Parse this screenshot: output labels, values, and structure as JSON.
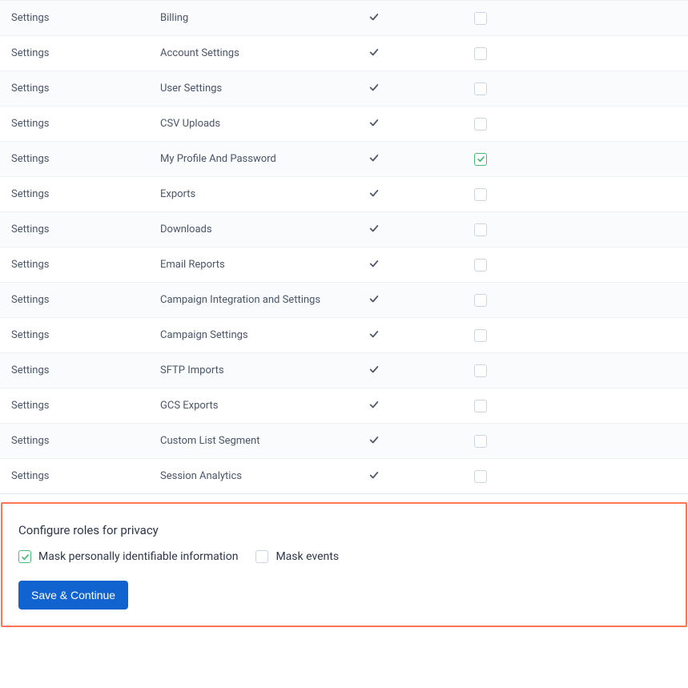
{
  "rows": [
    {
      "category": "Settings",
      "name": "Billing",
      "enabled": true,
      "checked": false
    },
    {
      "category": "Settings",
      "name": "Account Settings",
      "enabled": true,
      "checked": false
    },
    {
      "category": "Settings",
      "name": "User Settings",
      "enabled": true,
      "checked": false
    },
    {
      "category": "Settings",
      "name": "CSV Uploads",
      "enabled": true,
      "checked": false
    },
    {
      "category": "Settings",
      "name": "My Profile And Password",
      "enabled": true,
      "checked": true
    },
    {
      "category": "Settings",
      "name": "Exports",
      "enabled": true,
      "checked": false
    },
    {
      "category": "Settings",
      "name": "Downloads",
      "enabled": true,
      "checked": false
    },
    {
      "category": "Settings",
      "name": "Email Reports",
      "enabled": true,
      "checked": false
    },
    {
      "category": "Settings",
      "name": "Campaign Integration and Settings",
      "enabled": true,
      "checked": false
    },
    {
      "category": "Settings",
      "name": "Campaign Settings",
      "enabled": true,
      "checked": false
    },
    {
      "category": "Settings",
      "name": "SFTP Imports",
      "enabled": true,
      "checked": false
    },
    {
      "category": "Settings",
      "name": "GCS Exports",
      "enabled": true,
      "checked": false
    },
    {
      "category": "Settings",
      "name": "Custom List Segment",
      "enabled": true,
      "checked": false
    },
    {
      "category": "Settings",
      "name": "Session Analytics",
      "enabled": true,
      "checked": false
    }
  ],
  "privacy": {
    "title": "Configure roles for privacy",
    "options": [
      {
        "label": "Mask personally identifiable information",
        "checked": true
      },
      {
        "label": "Mask events",
        "checked": false
      }
    ],
    "save_label": "Save & Continue"
  }
}
